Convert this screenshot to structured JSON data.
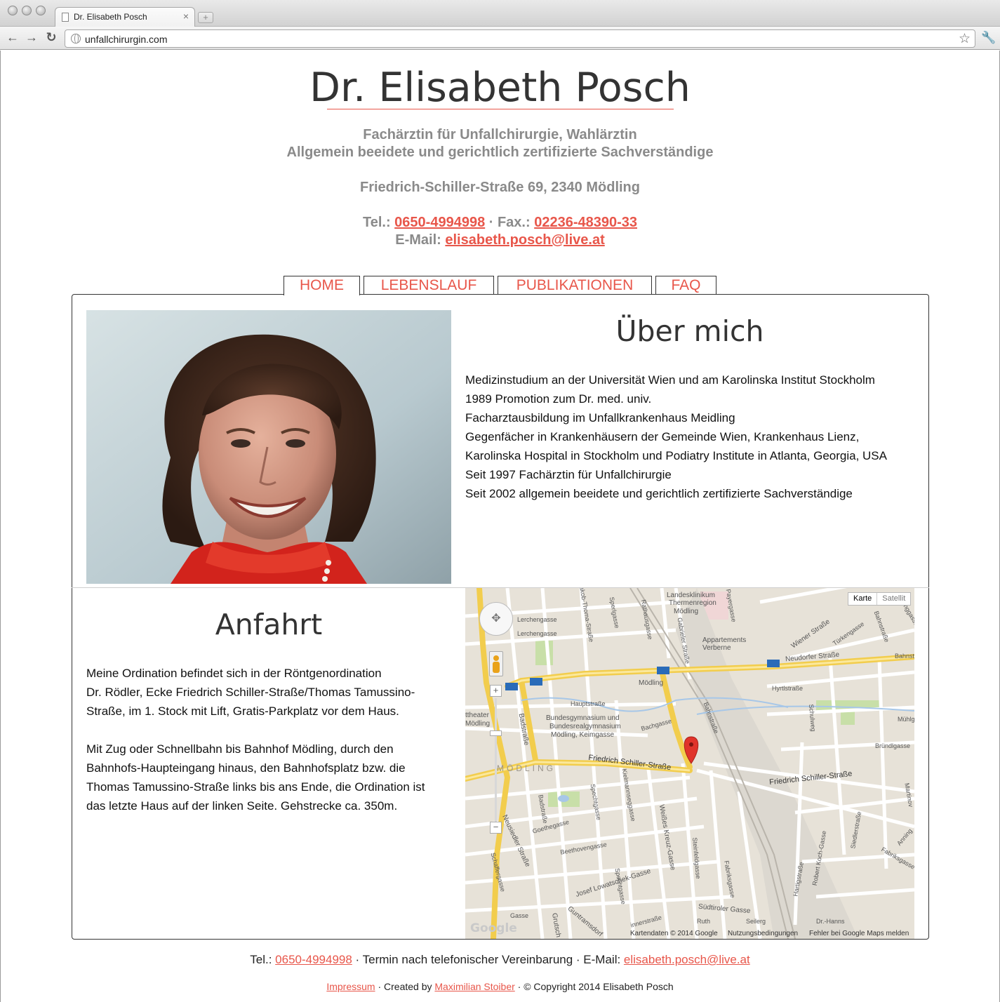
{
  "browser": {
    "tab_title": "Dr. Elisabeth Posch",
    "url": "unfallchirurgin.com"
  },
  "header": {
    "title": "Dr. Elisabeth Posch",
    "subtitle_1": "Fachärztin für Unfallchirurgie, Wahlärztin",
    "subtitle_2": "Allgemein beeidete und gerichtlich zertifizierte Sachverständige",
    "address": "Friedrich-Schiller-Straße 69, 2340 Mödling",
    "tel_label": "Tel.: ",
    "tel": "0650-4994998",
    "fax_label": " · Fax.: ",
    "fax": "02236-48390-33",
    "email_label": "E-Mail: ",
    "email": "elisabeth.posch@live.at"
  },
  "nav": {
    "tabs": [
      {
        "label": "HOME"
      },
      {
        "label": "LEBENSLAUF"
      },
      {
        "label": "PUBLIKATIONEN"
      },
      {
        "label": "FAQ"
      }
    ],
    "active_index": 0
  },
  "about": {
    "heading": "Über mich",
    "lines": [
      "Medizinstudium an der Universität Wien und am Karolinska Institut Stockholm",
      "1989 Promotion zum Dr. med. univ.",
      "Facharztausbildung im Unfallkrankenhaus Meidling",
      "Gegenfächer in Krankenhäusern der Gemeinde Wien, Krankenhaus Lienz,",
      "Karolinska Hospital in Stockholm und Podiatry Institute in Atlanta, Georgia, USA",
      "Seit 1997 Fachärztin für Unfallchirurgie",
      "Seit 2002 allgemein beeidete und gerichtlich zertifizierte Sachverständige"
    ]
  },
  "directions": {
    "heading": "Anfahrt",
    "para1_lines": [
      "Meine Ordination befindet sich in der Röntgenordination",
      "Dr. Rödler, Ecke Friedrich Schiller-Straße/Thomas Tamussino-",
      "Straße, im 1. Stock mit Lift, Gratis-Parkplatz vor dem Haus."
    ],
    "para2_lines": [
      "Mit Zug oder Schnellbahn bis Bahnhof Mödling, durch den",
      "Bahnhofs-Haupteingang hinaus, den Bahnhofsplatz bzw. die",
      "Thomas Tamussino-Straße links bis ans Ende, die Ordination ist",
      "das letzte Haus auf der linken Seite. Gehstrecke ca. 350m."
    ]
  },
  "map": {
    "type_map": "Karte",
    "type_satellite": "Satellit",
    "zoom_in": "+",
    "zoom_out": "−",
    "google_logo": "Google",
    "footer_data": "Kartendaten © 2014 Google",
    "footer_terms": "Nutzungsbedingungen",
    "footer_report": "Fehler bei Google Maps melden",
    "labels": [
      "Landesklinikum",
      "Thermenregion",
      "Mödling",
      "Lerchengasse",
      "Appartements",
      "Verberne",
      "Wiener Straße",
      "Türkengasse",
      "Neudorfer Straße",
      "Bahnstraße",
      "Mödling",
      "Hyrtlstraße",
      "ttheater",
      "Mödling",
      "Bundesgymnasium und",
      "Bundesrealgymnasium",
      "Mödling, Keimgasse",
      "Bachgasse",
      "Badstraße",
      "MÖDLING",
      "Friedrich Schiller-Straße",
      "Friedrich Schiller-Straße",
      "Bründlgasse",
      "Schulweg",
      "Mühlg",
      "Neusiedler Straße",
      "Goethegasse",
      "Beethovengasse",
      "Josef Lowatschek-Gasse",
      "Weißes Kreuz-Gasse",
      "Steinfeldgasse",
      "Südtiroler Gasse",
      "Robert Koch-Gasse",
      "Hartigstraße",
      "Siedlerstraße",
      "Jakob-Thoma-Straße",
      "Gabrieler Straße",
      "Payergasse",
      "Schaffergasse",
      "Fabriksgasse",
      "Guntramsdorf",
      "Fabriksgasse",
      "Kielmannseggasse",
      "Spechtgasse",
      "Badstraße",
      "Gasse",
      "Grutsch",
      "Bahnstraße",
      "innerstraße",
      "Spechtgasse",
      "Martinov",
      "Anning",
      "Ringgasse",
      "Bahnstra",
      "Sperlgasse",
      "Rathausgasse",
      "Ruth",
      "Seilerg",
      "Dr.-Hanns",
      "Lerchengasse",
      "Hauptstraße"
    ]
  },
  "footer": {
    "tel_label": "Tel.: ",
    "tel": "0650-4994998",
    "middle": " · Termin nach telefonischer Vereinbarung · E-Mail: ",
    "email": "elisabeth.posch@live.at",
    "impressum": "Impressum",
    "created_by": " · Created by ",
    "creator": "Maximilian Stoiber",
    "copyright": " · © Copyright 2014 Elisabeth Posch"
  },
  "colors": {
    "accent": "#e8564a",
    "heading": "#333333",
    "subtle": "#8a8a8a",
    "map_road": "#f5d45a",
    "map_bg": "#e7e2d8"
  }
}
